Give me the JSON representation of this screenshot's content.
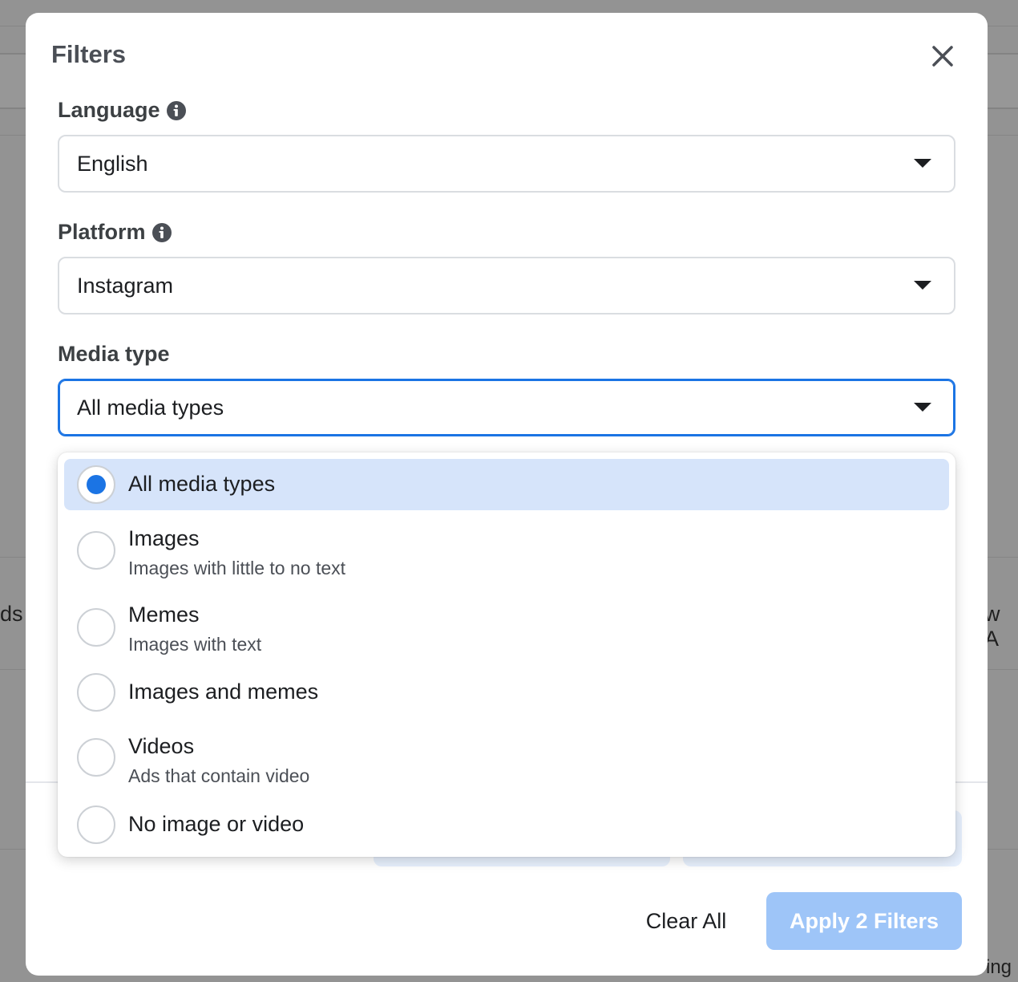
{
  "modal": {
    "title": "Filters",
    "close_icon": "close-icon"
  },
  "language": {
    "label": "Language",
    "info_icon": "info-icon",
    "value": "English"
  },
  "platform": {
    "label": "Platform",
    "info_icon": "info-icon",
    "value": "Instagram"
  },
  "media_type": {
    "label": "Media type",
    "value": "All media types",
    "options": [
      {
        "title": "All media types",
        "description": "",
        "selected": true
      },
      {
        "title": "Images",
        "description": "Images with little to no text",
        "selected": false
      },
      {
        "title": "Memes",
        "description": "Images with text",
        "selected": false
      },
      {
        "title": "Images and memes",
        "description": "",
        "selected": false
      },
      {
        "title": "Videos",
        "description": "Ads that contain video",
        "selected": false
      },
      {
        "title": "No image or video",
        "description": "",
        "selected": false
      }
    ]
  },
  "footer": {
    "clear_label": "Clear All",
    "apply_label": "Apply 2 Filters"
  },
  "background": {
    "left_fragment": "ds",
    "right_fragment": "w A",
    "bottom_right_fragment": "ing"
  },
  "colors": {
    "accent": "#1b74e4",
    "selected_bg": "#d6e4fa",
    "apply_disabled": "#9ec5f8"
  }
}
